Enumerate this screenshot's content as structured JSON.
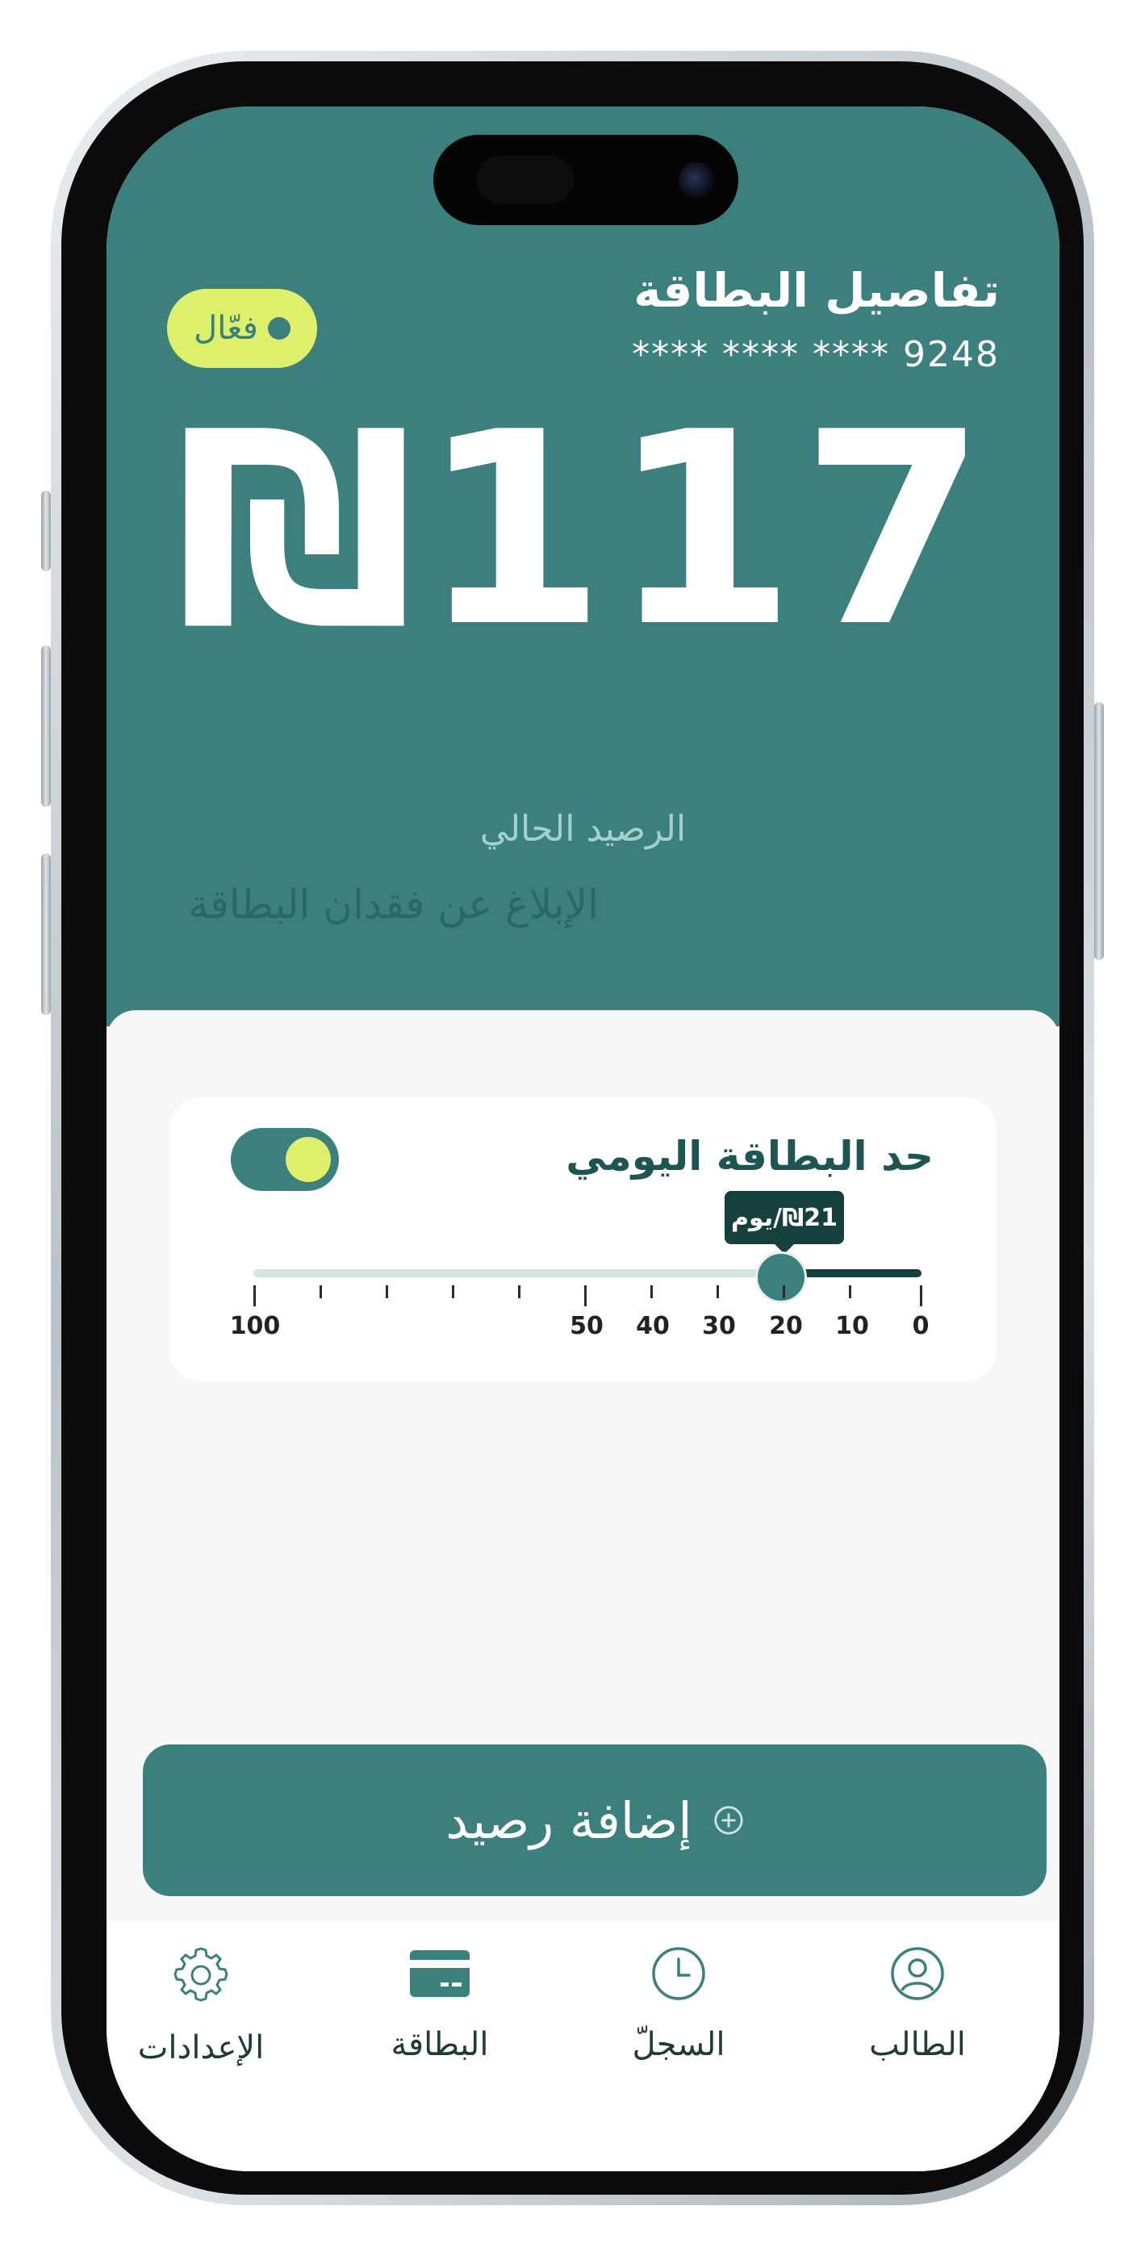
{
  "header": {
    "title": "تفاصيل البطاقة",
    "card_number": "**** **** **** 9248",
    "status_badge": "فعّال"
  },
  "balance": {
    "amount_display": "₪117",
    "label": "الرصيد الحالي"
  },
  "report_lost_link": "الإبلاغ عن فقدان البطاقة",
  "daily_limit": {
    "title": "حد البطاقة اليومي",
    "enabled": true,
    "value": 21,
    "value_label": "₪21/يوم",
    "scale_labels": [
      "0",
      "10",
      "20",
      "30",
      "40",
      "50",
      "100"
    ]
  },
  "add_balance_button": "إضافة رصيد",
  "bottom_nav": {
    "items": [
      {
        "label": "الطالب",
        "icon": "user-icon"
      },
      {
        "label": "السجلّ",
        "icon": "clock-icon"
      },
      {
        "label": "البطاقة",
        "icon": "card-icon"
      },
      {
        "label": "الإعدادات",
        "icon": "gear-icon"
      }
    ]
  },
  "colors": {
    "primary": "#3b807c",
    "accent": "#def06b",
    "dark": "#16403d"
  }
}
